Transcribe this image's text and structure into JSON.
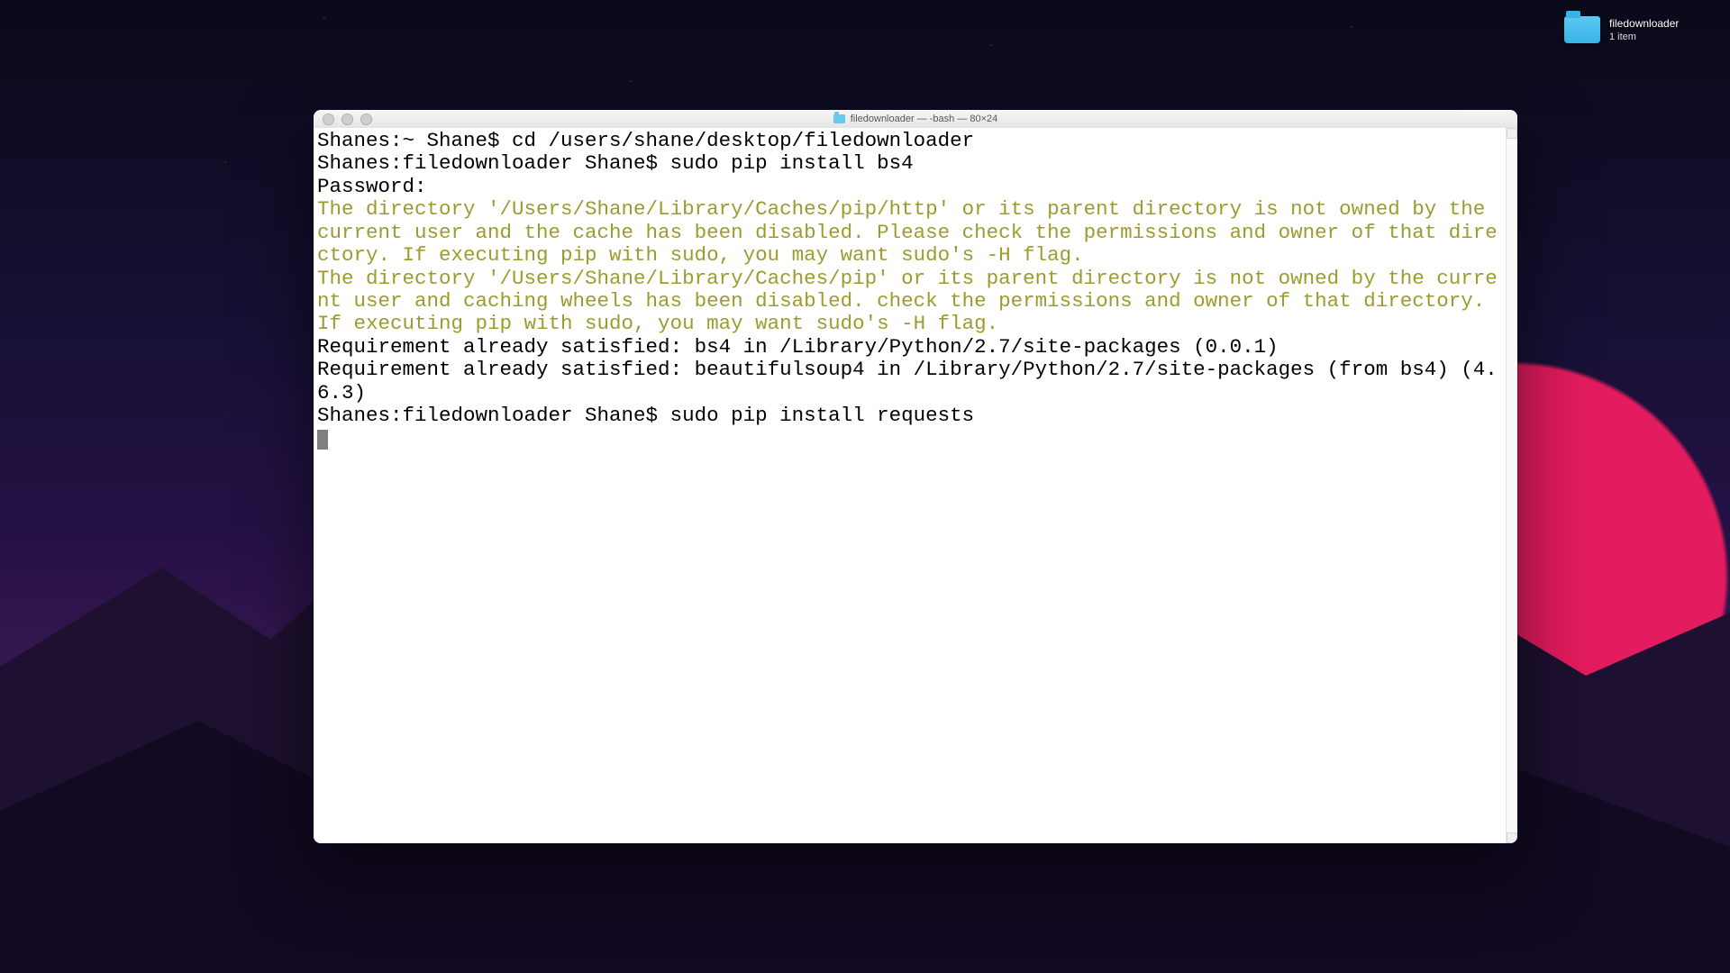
{
  "desktop": {
    "folder_name": "filedownloader",
    "folder_subtitle": "1 item"
  },
  "window": {
    "title": "filedownloader — -bash — 80×24",
    "traffic_dim": true
  },
  "terminal": {
    "lines": [
      {
        "style": "plain",
        "text": "Shanes:~ Shane$ cd /users/shane/desktop/filedownloader"
      },
      {
        "style": "plain",
        "text": "Shanes:filedownloader Shane$ sudo pip install bs4"
      },
      {
        "style": "plain",
        "text": "Password:"
      },
      {
        "style": "warn",
        "text": "The directory '/Users/Shane/Library/Caches/pip/http' or its parent directory is not owned by the current user and the cache has been disabled. Please check the permissions and owner of that directory. If executing pip with sudo, you may want sudo's -H flag."
      },
      {
        "style": "warn",
        "text": "The directory '/Users/Shane/Library/Caches/pip' or its parent directory is not owned by the current user and caching wheels has been disabled. check the permissions and owner of that directory. If executing pip with sudo, you may want sudo's -H flag."
      },
      {
        "style": "plain",
        "text": "Requirement already satisfied: bs4 in /Library/Python/2.7/site-packages (0.0.1)"
      },
      {
        "style": "plain",
        "text": "Requirement already satisfied: beautifulsoup4 in /Library/Python/2.7/site-packages (from bs4) (4.6.3)"
      },
      {
        "style": "plain",
        "text": "Shanes:filedownloader Shane$ sudo pip install requests"
      }
    ],
    "show_cursor_on_new_line": true
  }
}
